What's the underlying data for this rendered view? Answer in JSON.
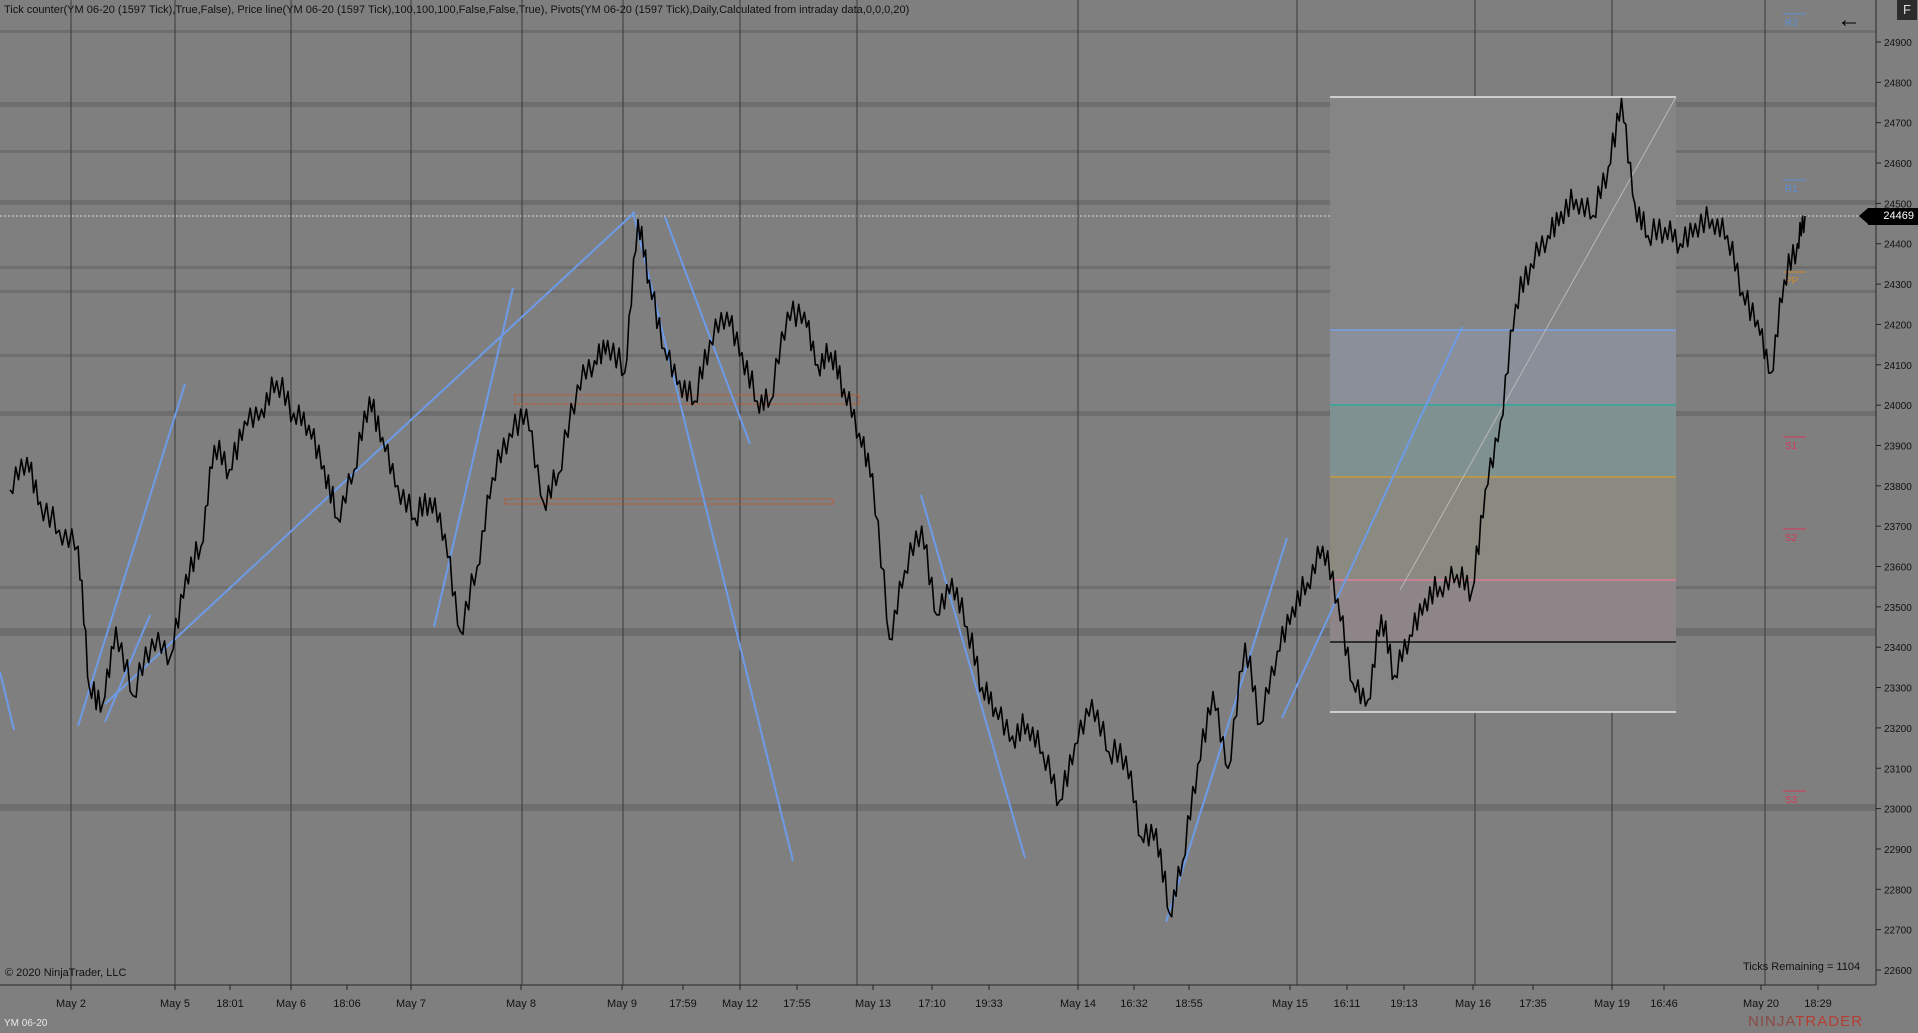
{
  "header": {
    "indicators_text": "Tick counter(YM 06-20 (1597 Tick),True,False), Price line(YM 06-20 (1597 Tick),100,100,100,False,False,True), Pivots(YM 06-20 (1597 Tick),Daily,Calculated from intraday data,0,0,0,20)"
  },
  "footer": {
    "copyright": "© 2020 NinjaTrader, LLC",
    "ticks_remaining": "Ticks Remaining = 1104",
    "instrument": "YM 06-20",
    "brand_left": "NINJA",
    "brand_right": "TRADER"
  },
  "toolbar": {
    "back_icon": "←",
    "f_button": "F"
  },
  "current_price": "24469",
  "colors": {
    "background": "#7f7f7f",
    "trendline": "#6d9be8",
    "pivot_blue": "#5a8fd6",
    "pivot_red": "#d6395a",
    "pivot_orange": "#d08a2a",
    "price_bar": "#000000",
    "zone": "#c0552a"
  },
  "chart_data": {
    "type": "line",
    "symbol": "YM 06-20",
    "bar_type": "1597 Tick",
    "ylim": [
      22550,
      24980
    ],
    "current_price": 24469,
    "y_ticks": [
      "24900",
      "24800",
      "24700",
      "24600",
      "24500",
      "24400",
      "24300",
      "24200",
      "24100",
      "24000",
      "23900",
      "23800",
      "23700",
      "23600",
      "23500",
      "23400",
      "23300",
      "23200",
      "23100",
      "23000",
      "22900",
      "22800",
      "22700",
      "22600"
    ],
    "x_ticks": [
      "May 2",
      "May 5",
      "18:01",
      "May 6",
      "18:06",
      "May 7",
      "May 8",
      "May 9",
      "17:59",
      "May 12",
      "17:55",
      "May 13",
      "17:10",
      "19:33",
      "May 14",
      "16:32",
      "18:55",
      "May 15",
      "16:11",
      "19:13",
      "May 16",
      "17:35",
      "May 19",
      "16:46",
      "May 20",
      "18:29"
    ],
    "price_path": [
      [
        0,
        23790
      ],
      [
        0.9,
        23870
      ],
      [
        1.6,
        23760
      ],
      [
        2.6,
        23690
      ],
      [
        3.6,
        23650
      ],
      [
        4.2,
        23300
      ],
      [
        4.9,
        23260
      ],
      [
        5.6,
        23450
      ],
      [
        6.5,
        23280
      ],
      [
        7.5,
        23420
      ],
      [
        8.5,
        23380
      ],
      [
        9.3,
        23580
      ],
      [
        10.1,
        23650
      ],
      [
        10.8,
        23900
      ],
      [
        11.6,
        23840
      ],
      [
        12.4,
        23960
      ],
      [
        13.3,
        23990
      ],
      [
        14.1,
        24060
      ],
      [
        15,
        23980
      ],
      [
        15.8,
        23950
      ],
      [
        16.6,
        23850
      ],
      [
        17.3,
        23720
      ],
      [
        18.2,
        23840
      ],
      [
        19,
        24020
      ],
      [
        19.7,
        23920
      ],
      [
        20.5,
        23800
      ],
      [
        21.4,
        23720
      ],
      [
        22.2,
        23770
      ],
      [
        23,
        23680
      ],
      [
        23.8,
        23440
      ],
      [
        24.7,
        23600
      ],
      [
        25.5,
        23820
      ],
      [
        26.4,
        23930
      ],
      [
        27.3,
        23990
      ],
      [
        28.2,
        23760
      ],
      [
        29,
        23830
      ],
      [
        30,
        24050
      ],
      [
        30.9,
        24110
      ],
      [
        31.6,
        24160
      ],
      [
        32.5,
        24080
      ],
      [
        33.2,
        24460
      ],
      [
        33.8,
        24310
      ],
      [
        34.6,
        24140
      ],
      [
        35.4,
        24060
      ],
      [
        36.2,
        24010
      ],
      [
        37,
        24160
      ],
      [
        37.9,
        24230
      ],
      [
        38.7,
        24130
      ],
      [
        39.5,
        24010
      ],
      [
        40.2,
        24010
      ],
      [
        41.1,
        24230
      ],
      [
        42,
        24230
      ],
      [
        42.7,
        24100
      ],
      [
        43.4,
        24130
      ],
      [
        44.1,
        24040
      ],
      [
        44.9,
        23930
      ],
      [
        45.6,
        23830
      ],
      [
        46.5,
        23420
      ],
      [
        47.3,
        23590
      ],
      [
        48.2,
        23700
      ],
      [
        49,
        23480
      ],
      [
        49.8,
        23570
      ],
      [
        50.6,
        23450
      ],
      [
        51.4,
        23300
      ],
      [
        52.1,
        23250
      ],
      [
        53,
        23180
      ],
      [
        53.8,
        23210
      ],
      [
        54.6,
        23140
      ],
      [
        55.5,
        23020
      ],
      [
        56.3,
        23160
      ],
      [
        57.2,
        23270
      ],
      [
        58.1,
        23140
      ],
      [
        59,
        23130
      ],
      [
        59.8,
        22930
      ],
      [
        60.6,
        22950
      ],
      [
        61.3,
        22740
      ],
      [
        62,
        22870
      ],
      [
        62.8,
        23110
      ],
      [
        63.6,
        23290
      ],
      [
        64.4,
        23100
      ],
      [
        65.3,
        23410
      ],
      [
        66.1,
        23210
      ],
      [
        67,
        23390
      ],
      [
        67.8,
        23500
      ],
      [
        68.6,
        23560
      ],
      [
        69.4,
        23650
      ],
      [
        70.2,
        23520
      ],
      [
        71,
        23310
      ],
      [
        71.8,
        23270
      ],
      [
        72.5,
        23480
      ],
      [
        73.2,
        23330
      ],
      [
        74,
        23430
      ],
      [
        74.8,
        23520
      ],
      [
        75.6,
        23550
      ],
      [
        76.5,
        23580
      ],
      [
        77.3,
        23540
      ],
      [
        78,
        23790
      ],
      [
        78.8,
        23960
      ],
      [
        79.6,
        24250
      ],
      [
        80.4,
        24350
      ],
      [
        81.3,
        24420
      ],
      [
        82,
        24480
      ],
      [
        82.8,
        24510
      ],
      [
        83.7,
        24470
      ],
      [
        84.5,
        24590
      ],
      [
        85.2,
        24760
      ],
      [
        85.9,
        24500
      ],
      [
        86.6,
        24420
      ],
      [
        87.5,
        24440
      ],
      [
        88.3,
        24400
      ],
      [
        89.1,
        24450
      ],
      [
        90,
        24460
      ],
      [
        90.8,
        24420
      ],
      [
        91.6,
        24280
      ],
      [
        92.4,
        24210
      ],
      [
        93.1,
        24080
      ],
      [
        93.8,
        24310
      ],
      [
        94.5,
        24400
      ],
      [
        94.9,
        24469
      ]
    ]
  }
}
